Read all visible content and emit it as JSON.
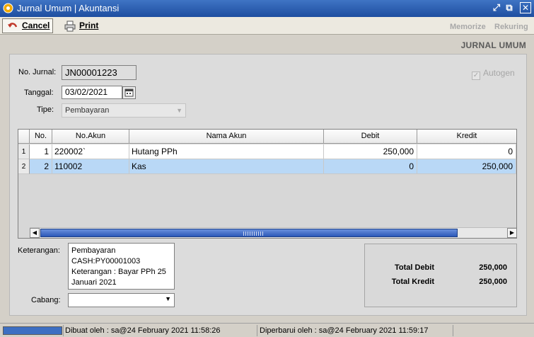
{
  "window": {
    "title": "Jurnal Umum | Akuntansi",
    "accent": "#1e4ea0"
  },
  "toolbar": {
    "cancel_label": "Cancel",
    "print_label": "Print",
    "memorize_label": "Memorize",
    "rekuring_label": "Rekuring"
  },
  "page": {
    "title": "JURNAL UMUM"
  },
  "form": {
    "no_jurnal_label": "No. Jurnal:",
    "no_jurnal_value": "JN00001223",
    "tanggal_label": "Tanggal:",
    "tanggal_value": "03/02/2021",
    "tipe_label": "Tipe:",
    "tipe_value": "Pembayaran",
    "autogen_label": "Autogen",
    "autogen_checked": true
  },
  "grid": {
    "columns": [
      "No.",
      "No.Akun",
      "Nama Akun",
      "Debit",
      "Kredit"
    ],
    "rows": [
      {
        "row_num": "1",
        "no": "1",
        "no_akun": "220002`",
        "nama_akun": "Hutang PPh",
        "debit": "250,000",
        "kredit": "0"
      },
      {
        "row_num": "2",
        "no": "2",
        "no_akun": "110002",
        "nama_akun": "Kas",
        "debit": "0",
        "kredit": "250,000"
      }
    ],
    "selected_row": 2
  },
  "footer": {
    "keterangan_label": "Keterangan:",
    "keterangan_lines": [
      "Pembayaran",
      "CASH:PY00001003",
      "Keterangan : Bayar PPh 25",
      "Januari 2021"
    ],
    "cabang_label": "Cabang:",
    "cabang_value": ""
  },
  "totals": {
    "debit_label": "Total Debit",
    "debit_value": "250,000",
    "kredit_label": "Total Kredit",
    "kredit_value": "250,000"
  },
  "status": {
    "created": "Dibuat oleh : sa@24 February 2021  11:58:26",
    "updated": "Diperbarui oleh : sa@24 February 2021  11:59:17"
  }
}
